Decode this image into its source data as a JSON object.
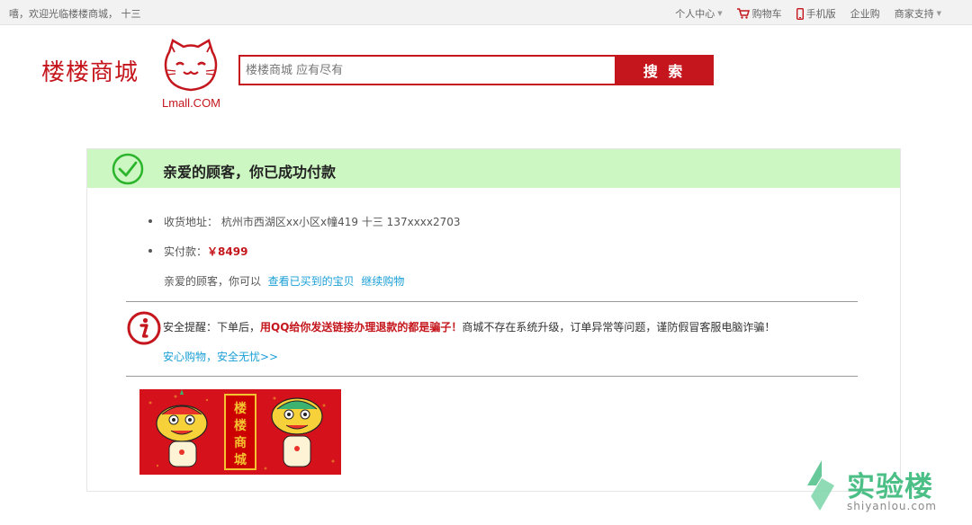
{
  "topbar": {
    "welcome": "嘻，欢迎光临楼楼商城， 十三",
    "personal_center": "个人中心",
    "cart": "购物车",
    "mobile": "手机版",
    "enterprise": "企业购",
    "merchant_support": "商家支持"
  },
  "header": {
    "logo_text": "楼楼商城",
    "logo_sub": "Lmall.COM",
    "search_placeholder": "楼楼商城 应有尽有",
    "search_button": "搜 索"
  },
  "success": {
    "title": "亲爱的顾客，你已成功付款"
  },
  "order": {
    "address_label": "收货地址：",
    "address_value": "杭州市西湖区xx小区x幢419 十三 137xxxx2703",
    "paid_label": "实付款：",
    "paid_value": "￥8499",
    "actions_prefix": "亲爱的顾客，你可以",
    "view_purchased": "查看已买到的宝贝",
    "continue_shopping": "继续购物"
  },
  "safety": {
    "prefix": "安全提醒：下单后，",
    "warning": "用QQ给你发送链接办理退款的都是骗子！",
    "suffix": "商城不存在系统升级，订单异常等问题，谨防假冒客服电脑诈骗！",
    "link": "安心购物，安全无忧>>"
  },
  "banner": {
    "text": "楼楼商城"
  },
  "watermark": {
    "text": "实验楼",
    "sub": "shiyanlou.com"
  },
  "colors": {
    "brand_red": "#c4161c",
    "success_bg": "#cdf7c2",
    "success_green": "#2cb52c",
    "link_blue": "#1a9fd6"
  }
}
